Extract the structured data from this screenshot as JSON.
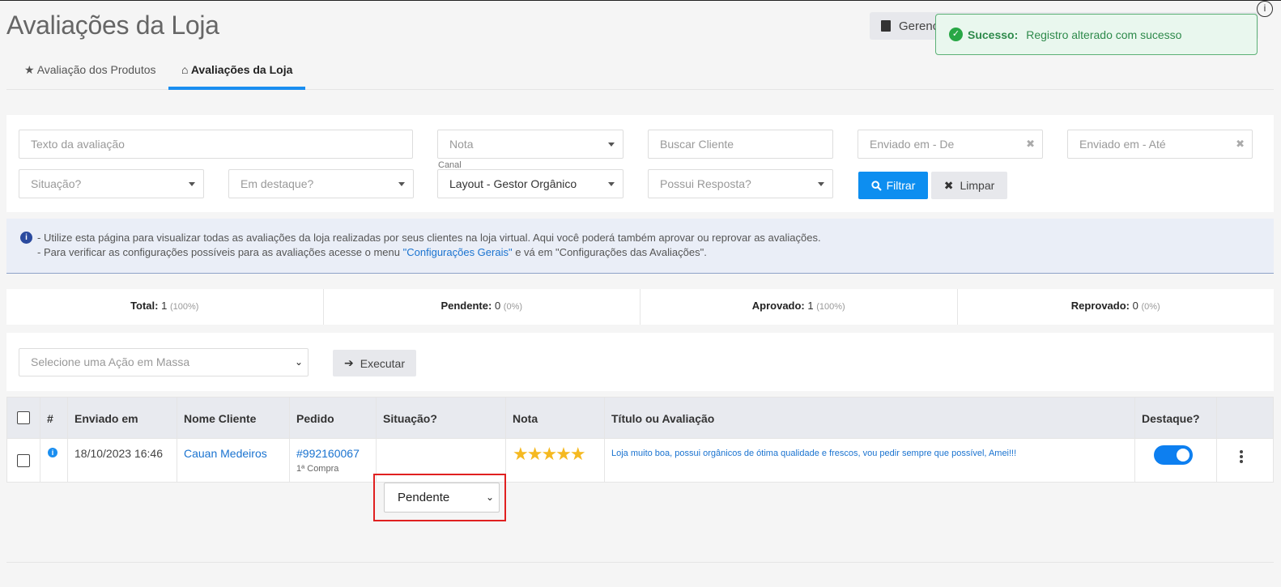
{
  "page": {
    "title": "Avaliações da Loja"
  },
  "top_button": {
    "label": "Gerenc"
  },
  "toast": {
    "title": "Sucesso:",
    "message": "Registro alterado com sucesso"
  },
  "tabs": [
    {
      "icon": "★",
      "label": "Avaliação dos Produtos"
    },
    {
      "icon": "⌂",
      "label": "Avaliações da Loja"
    }
  ],
  "filters": {
    "texto": "Texto da avaliação",
    "nota": "Nota",
    "buscar_cliente": "Buscar Cliente",
    "enviado_de": "Enviado em - De",
    "enviado_ate": "Enviado em - Até",
    "situacao": "Situação?",
    "destaque": "Em destaque?",
    "canal_label": "Canal",
    "canal_value": "Layout - Gestor Orgânico",
    "possui_resposta": "Possui Resposta?",
    "filtrar": "Filtrar",
    "limpar": "Limpar"
  },
  "info": {
    "line1": "- Utilize esta página para visualizar todas as avaliações da loja realizadas por seus clientes na loja virtual. Aqui você poderá também aprovar ou reprovar as avaliações.",
    "line2_prefix": "- Para verificar as configurações possíveis para as avaliações acesse o menu ",
    "line2_link": "\"Configurações Gerais\"",
    "line2_suffix": " e vá em \"Configurações das Avaliações\"."
  },
  "stats": [
    {
      "label": "Total:",
      "value": "1",
      "pct": "(100%)"
    },
    {
      "label": "Pendente:",
      "value": "0",
      "pct": "(0%)"
    },
    {
      "label": "Aprovado:",
      "value": "1",
      "pct": "(100%)"
    },
    {
      "label": "Reprovado:",
      "value": "0",
      "pct": "(0%)"
    }
  ],
  "mass_action": {
    "placeholder": "Selecione uma Ação em Massa",
    "execute": "Executar"
  },
  "table": {
    "headers": [
      "#",
      "Enviado em",
      "Nome Cliente",
      "Pedido",
      "Situação?",
      "Nota",
      "Título ou Avaliação",
      "Destaque?"
    ],
    "rows": [
      {
        "date": "18/10/2023 16:46",
        "client": "Cauan Medeiros",
        "order": "#992160067",
        "order_note": "1ª Compra",
        "status": "Pendente",
        "stars": "★★★★★",
        "rating": 5,
        "review": "Loja muito boa, possui orgânicos de ótima qualidade e frescos, vou pedir sempre que possível, Amei!!!",
        "featured": true
      }
    ]
  },
  "colors": {
    "primary": "#0d8ef0",
    "success": "#28a745",
    "highlight": "#e02020",
    "star": "#f5b921"
  }
}
